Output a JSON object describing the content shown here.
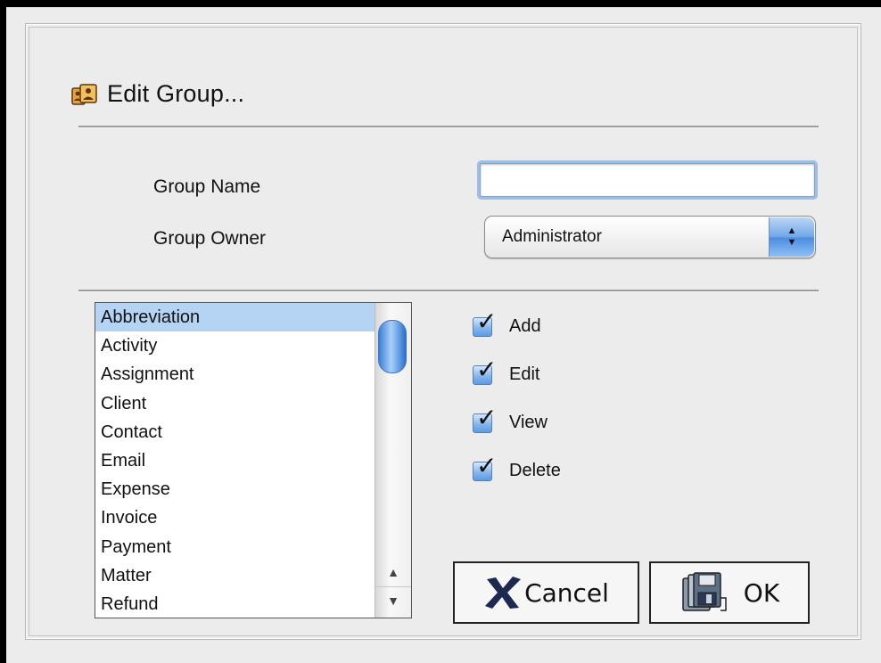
{
  "dialog": {
    "title": "Edit Group...",
    "title_icon": "group-icon"
  },
  "fields": {
    "group_name_label": "Group Name",
    "group_name_value": "",
    "group_owner_label": "Group Owner",
    "group_owner_value": "Administrator"
  },
  "list": {
    "items": [
      "Abbreviation",
      "Activity",
      "Assignment",
      "Client",
      "Contact",
      "Email",
      "Expense",
      "Invoice",
      "Payment",
      "Matter",
      "Refund"
    ],
    "selected": "Abbreviation"
  },
  "permissions": [
    {
      "label": "Add",
      "checked": true
    },
    {
      "label": "Edit",
      "checked": true
    },
    {
      "label": "View",
      "checked": true
    },
    {
      "label": "Delete",
      "checked": true
    }
  ],
  "buttons": {
    "cancel_label": "Cancel",
    "cancel_icon": "x-icon",
    "ok_label": "OK",
    "ok_icon": "save-disk-icon"
  },
  "colors": {
    "window_bg": "#ececec",
    "selection": "#b5d3f3",
    "focus_ring": "#9bbfe6",
    "accent_blue": "#4b8de0",
    "cancel_x": "#1c2a52"
  }
}
